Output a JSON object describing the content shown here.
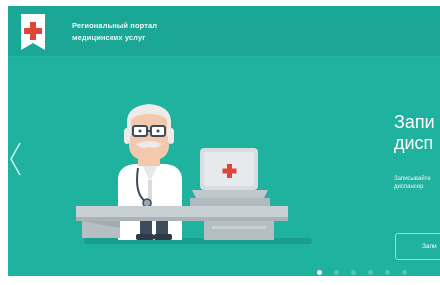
{
  "header": {
    "portal_line1": "Региональный портал",
    "portal_line2": "медицинских услуг",
    "logo_icon": "red-cross-flag-icon"
  },
  "hero": {
    "title_line1": "Запи",
    "title_line2": "дисп",
    "desc_line1": "Записывайте",
    "desc_line2": "диспансер",
    "button_label": "Запи",
    "illustration": "doctor-at-desk-with-laptop",
    "prev_icon": "chevron-left-icon"
  },
  "carousel": {
    "slide_count": 6,
    "active_index": 0
  },
  "colors": {
    "background": "#1fb29f",
    "header": "#1aa796",
    "accent_red": "#e0453a",
    "text": "#ffffff"
  }
}
